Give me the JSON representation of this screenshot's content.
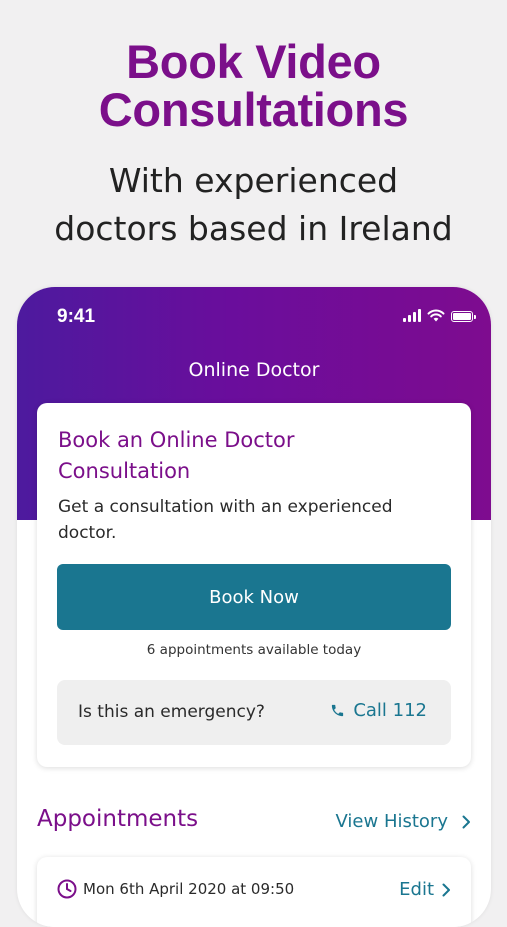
{
  "promo": {
    "title_line1": "Book Video",
    "title_line2": "Consultations",
    "subtitle_line1": "With experienced",
    "subtitle_line2": "doctors based in Ireland"
  },
  "status_bar": {
    "time": "9:41",
    "icons": [
      "signal-icon",
      "wifi-icon",
      "battery-icon"
    ]
  },
  "nav": {
    "title": "Online Doctor"
  },
  "book_card": {
    "heading_line1": "Book an Online Doctor",
    "heading_line2": "Consultation",
    "description_line1": "Get a consultation with an experienced",
    "description_line2": "doctor.",
    "button_label": "Book Now",
    "availability": "6 appointments available today",
    "emergency_question": "Is this an emergency?",
    "call_label": "Call 112"
  },
  "appointments": {
    "heading": "Appointments",
    "history_label": "View History",
    "items": [
      {
        "datetime": "Mon 6th April 2020 at 09:50",
        "edit_label": "Edit"
      }
    ]
  },
  "colors": {
    "brand_purple": "#7b0f8a",
    "header_gradient_start": "#4d1a9e",
    "header_gradient_end": "#7e0c8f",
    "teal": "#1a7690",
    "background": "#f1f0f1"
  }
}
